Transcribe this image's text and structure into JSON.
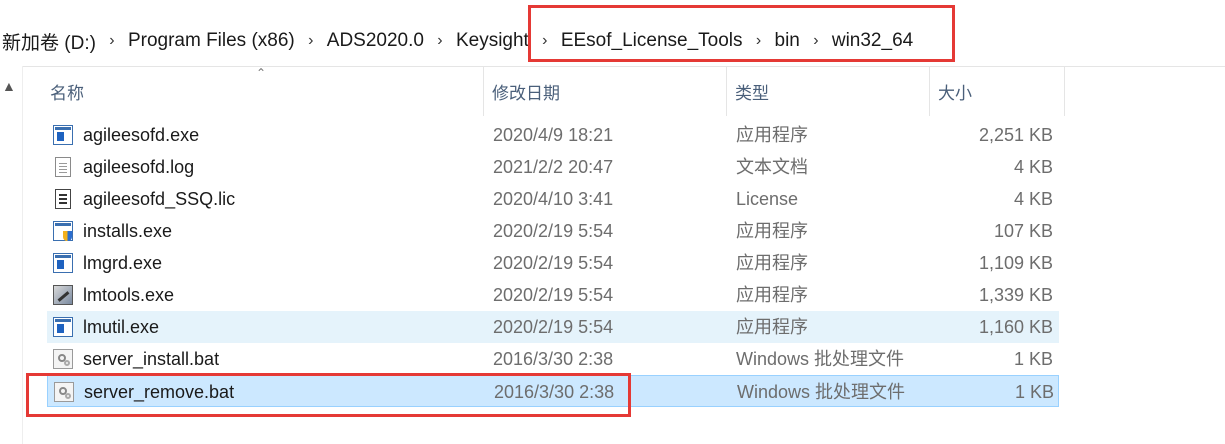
{
  "breadcrumb": {
    "items": [
      "新加卷 (D:)",
      "Program Files (x86)",
      "ADS2020.0",
      "Keysight",
      "EEsof_License_Tools",
      "bin",
      "win32_64"
    ],
    "separator": "›"
  },
  "columns": {
    "name": "名称",
    "modified": "修改日期",
    "type": "类型",
    "size": "大小"
  },
  "files": [
    {
      "name": "agileesofd.exe",
      "modified": "2020/4/9 18:21",
      "type": "应用程序",
      "size": "2,251 KB",
      "icon": "exe-icon"
    },
    {
      "name": "agileesofd.log",
      "modified": "2021/2/2 20:47",
      "type": "文本文档",
      "size": "4 KB",
      "icon": "text-document-icon"
    },
    {
      "name": "agileesofd_SSQ.lic",
      "modified": "2020/4/10 3:41",
      "type": "License",
      "size": "4 KB",
      "icon": "license-file-icon"
    },
    {
      "name": "installs.exe",
      "modified": "2020/2/19 5:54",
      "type": "应用程序",
      "size": "107 KB",
      "icon": "shield-exe-icon"
    },
    {
      "name": "lmgrd.exe",
      "modified": "2020/2/19 5:54",
      "type": "应用程序",
      "size": "1,109 KB",
      "icon": "exe-icon"
    },
    {
      "name": "lmtools.exe",
      "modified": "2020/2/19 5:54",
      "type": "应用程序",
      "size": "1,339 KB",
      "icon": "tools-icon"
    },
    {
      "name": "lmutil.exe",
      "modified": "2020/2/19 5:54",
      "type": "应用程序",
      "size": "1,160 KB",
      "icon": "exe-icon",
      "state": "hover"
    },
    {
      "name": "server_install.bat",
      "modified": "2016/3/30 2:38",
      "type": "Windows 批处理文件",
      "size": "1 KB",
      "icon": "batch-file-icon"
    },
    {
      "name": "server_remove.bat",
      "modified": "2016/3/30 2:38",
      "type": "Windows 批处理文件",
      "size": "1 KB",
      "icon": "batch-file-icon",
      "state": "selected"
    }
  ],
  "colors": {
    "highlight_box": "#e53935",
    "row_hover": "#e5f3fb",
    "row_selected": "#cce8ff",
    "header_text": "#4a5f7a"
  }
}
